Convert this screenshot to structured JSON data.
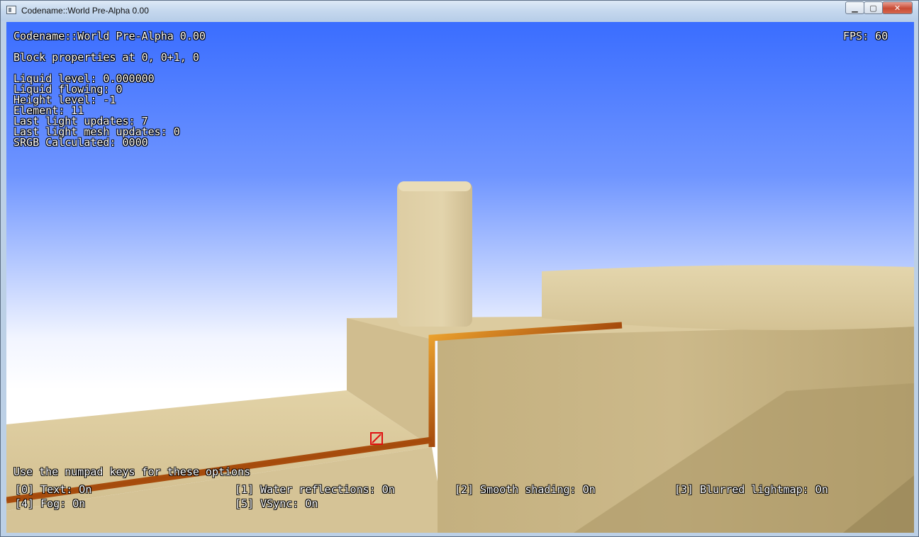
{
  "window": {
    "title": "Codename::World Pre-Alpha 0.00",
    "minimize_glyph": "▁",
    "maximize_glyph": "▢",
    "close_glyph": "✕"
  },
  "hud": {
    "app_title": "Codename::World Pre-Alpha 0.00",
    "fps": "FPS: 60",
    "block_properties": "Block properties at 0, 0+1, 0",
    "stats": [
      "Liquid level: 0.000000",
      "Liquid flowing: 0",
      "Height level: -1",
      "Element: 11",
      "Last light updates: 7",
      "Last light mesh updates: 0",
      "SRGB Calculated: 0000"
    ],
    "options_hint": "Use the numpad keys for these options",
    "options": [
      "[0] Text: On",
      "[1] Water reflections: On",
      "[2] Smooth shading: On",
      "[3] Blurred lightmap: On",
      "[4] Fog: On",
      "[5] VSync: On"
    ]
  },
  "colors": {
    "sky_top": "#3a6dff",
    "sand": "#d8c79e",
    "lava": "#c0711a",
    "cursor": "#e01010"
  }
}
